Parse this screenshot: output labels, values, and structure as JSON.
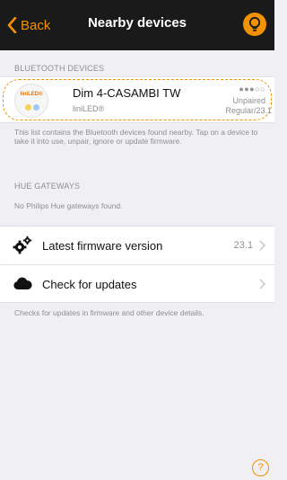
{
  "nav": {
    "back_label": "Back",
    "title": "Nearby devices"
  },
  "bluetooth": {
    "header": "BLUETOOTH DEVICES",
    "device": {
      "logo_text": "liniLED®",
      "name": "Dim 4-CASAMBI TW",
      "brand": "liniLED®",
      "signal": "●●●○○",
      "status": "Unpaired",
      "version": "Regular/23.1"
    },
    "note": "This list contains the Bluetooth devices found nearby. Tap on a device to take it into use, unpair, ignore or update firmware."
  },
  "hue": {
    "header": "HUE GATEWAYS",
    "note": "No Philips Hue gateways found."
  },
  "firmware": {
    "latest_label": "Latest firmware version",
    "latest_value": "23.1",
    "check_label": "Check for updates",
    "note": "Checks for updates in firmware and other device details."
  },
  "help": {
    "glyph": "?"
  },
  "colors": {
    "accent": "#f39200",
    "navbar": "#1a1a1a",
    "background": "#efeff4"
  },
  "icons": {
    "back": "chevron-left-icon",
    "nav_right": "lamp-icon",
    "firmware": "gears-icon",
    "update": "cloud-icon",
    "help": "help-icon"
  }
}
